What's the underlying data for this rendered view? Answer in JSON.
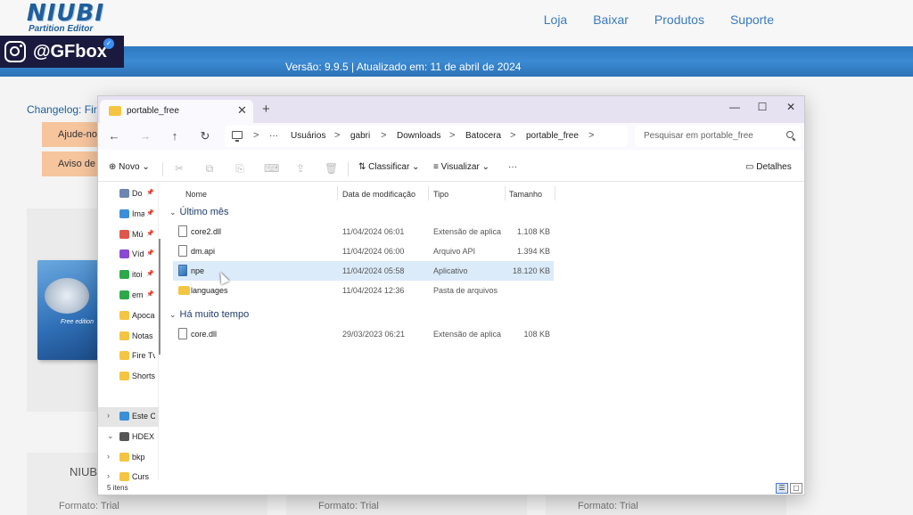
{
  "site": {
    "logo": "NIUBI",
    "logo_sub": "Partition Editor",
    "nav": [
      "Loja",
      "Baixar",
      "Produtos",
      "Suporte"
    ],
    "banner": "Versão: 9.9.5 | Atualizado em: 11 de abril de 2024",
    "changelog_label": "Changelog:",
    "changelog_text": "Fir",
    "help_button": "Ajude-no",
    "notice_button": "Aviso de",
    "product_box_label": "Free edition",
    "card_title": "NIUBI",
    "format_label": "Formato:",
    "format_value": "Trial"
  },
  "social": {
    "handle": "@GFbox",
    "check": "✓"
  },
  "explorer": {
    "tab_title": "portable_free",
    "tab_close": "✕",
    "tab_add": "+",
    "window_controls": [
      "—",
      "☐",
      "✕"
    ],
    "nav_buttons": [
      "←",
      "→",
      "↑",
      "↻"
    ],
    "address_more": "···",
    "breadcrumbs": [
      "Usuários",
      "gabri",
      "Downloads",
      "Batocera",
      "portable_free"
    ],
    "breadcrumb_sep": ">",
    "search_placeholder": "Pesquisar em portable_free",
    "toolbar": {
      "new": "Novo",
      "sort": "Classificar",
      "view": "Visualizar",
      "more": "···",
      "details": "Detalhes",
      "new_icon": "⊕",
      "sort_icon": "⇅",
      "view_icon": "≡",
      "details_icon": "▭",
      "chevron": "⌄",
      "actions": [
        "✂",
        "⧉",
        "⎘",
        "⌨",
        "⇪",
        "🗑"
      ]
    },
    "sidebar": [
      {
        "label": "Do",
        "color": "#6d86b0",
        "pinned": true
      },
      {
        "label": "Ima",
        "color": "#3a8fd8",
        "pinned": true
      },
      {
        "label": "Mú",
        "color": "#e0584d",
        "pinned": true
      },
      {
        "label": "Víd",
        "color": "#8a4ad1",
        "pinned": true
      },
      {
        "label": "itoi",
        "color": "#2da84a",
        "pinned": true
      },
      {
        "label": "em",
        "color": "#2da84a",
        "pinned": true
      },
      {
        "label": "Apoca",
        "color": "#f4c542",
        "pinned": false
      },
      {
        "label": "Notas",
        "color": "#f4c542",
        "pinned": false
      },
      {
        "label": "Fire Tv",
        "color": "#f4c542",
        "pinned": false
      },
      {
        "label": "Shorts",
        "color": "#f4c542",
        "pinned": false
      },
      {
        "label": "Este C",
        "color": "#3a8fd8",
        "pinned": false,
        "chev": "›",
        "selected": true
      },
      {
        "label": "HDEX",
        "color": "#555555",
        "pinned": false,
        "chev": "⌄"
      },
      {
        "label": "bkp",
        "color": "#f4c542",
        "pinned": false,
        "chev": "›"
      },
      {
        "label": "Curs",
        "color": "#f4c542",
        "pinned": false,
        "chev": "›"
      }
    ],
    "pin_glyph": "📌",
    "columns": [
      "Nome",
      "Data de modificação",
      "Tipo",
      "Tamanho"
    ],
    "groups": [
      {
        "label": "Último mês",
        "chev": "⌄",
        "files": [
          {
            "name": "core2.dll",
            "date": "11/04/2024 06:01",
            "type": "Extensão de aplica...",
            "size": "1.108 KB",
            "kind": "file"
          },
          {
            "name": "dm.api",
            "date": "11/04/2024 06:00",
            "type": "Arquivo API",
            "size": "1.394 KB",
            "kind": "file"
          },
          {
            "name": "npe",
            "date": "11/04/2024 05:58",
            "type": "Aplicativo",
            "size": "18.120 KB",
            "kind": "app",
            "selected": true
          },
          {
            "name": "languages",
            "date": "11/04/2024 12:36",
            "type": "Pasta de arquivos",
            "size": "",
            "kind": "folder"
          }
        ]
      },
      {
        "label": "Há muito tempo",
        "chev": "⌄",
        "files": [
          {
            "name": "core.dll",
            "date": "29/03/2023 06:21",
            "type": "Extensão de aplica...",
            "size": "108 KB",
            "kind": "file"
          }
        ]
      }
    ],
    "status": "5 itens",
    "view_buttons": [
      "☰",
      "▢"
    ]
  }
}
